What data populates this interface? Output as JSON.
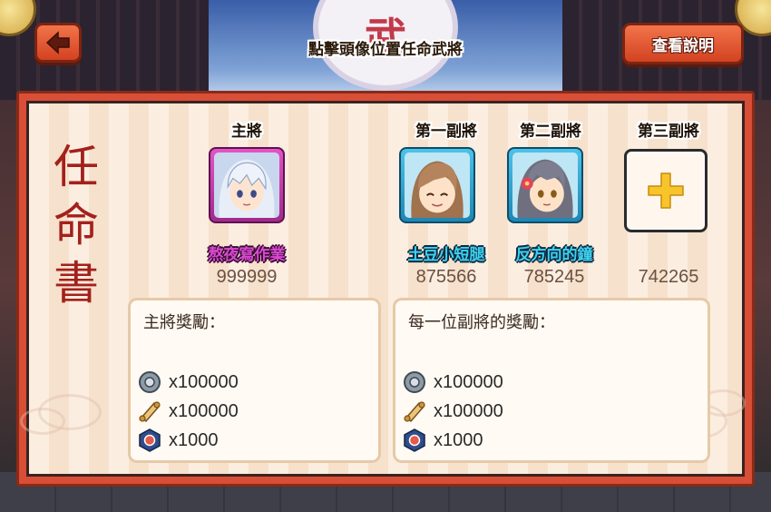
{
  "header": {
    "instruction": "點擊頭像位置任命武將",
    "help_label": "查看說明",
    "emblem_glyph": "武"
  },
  "panel": {
    "vertical_title": [
      "任",
      "命",
      "書"
    ]
  },
  "slots": [
    {
      "role": "主將",
      "name": "熬夜寫作業",
      "score": "999999",
      "frame": "main",
      "color": "#d84ad0"
    },
    {
      "role": "第一副將",
      "name": "土豆小短腿",
      "score": "875566",
      "frame": "sub",
      "color": "#3fd0f0"
    },
    {
      "role": "第二副將",
      "name": "反方向的鐘",
      "score": "785245",
      "frame": "sub",
      "color": "#3fd0f0"
    },
    {
      "role": "第三副將",
      "name": "",
      "score": "742265",
      "frame": "empty"
    }
  ],
  "rewards": {
    "main": {
      "title": "主將獎勵：",
      "items": [
        {
          "icon": "coin-icon",
          "amount": "x100000"
        },
        {
          "icon": "scroll-icon",
          "amount": "x100000"
        },
        {
          "icon": "emblem-token-icon",
          "amount": "x1000"
        }
      ]
    },
    "deputy": {
      "title": "每一位副將的獎勵：",
      "items": [
        {
          "icon": "coin-icon",
          "amount": "x100000"
        },
        {
          "icon": "scroll-icon",
          "amount": "x100000"
        },
        {
          "icon": "emblem-token-icon",
          "amount": "x1000"
        }
      ]
    }
  },
  "colors": {
    "button": "#d24222",
    "panel_frame": "#d94e36",
    "title_red": "#a3211b",
    "main_frame": "#e454c6",
    "sub_frame": "#4cc3ea"
  }
}
